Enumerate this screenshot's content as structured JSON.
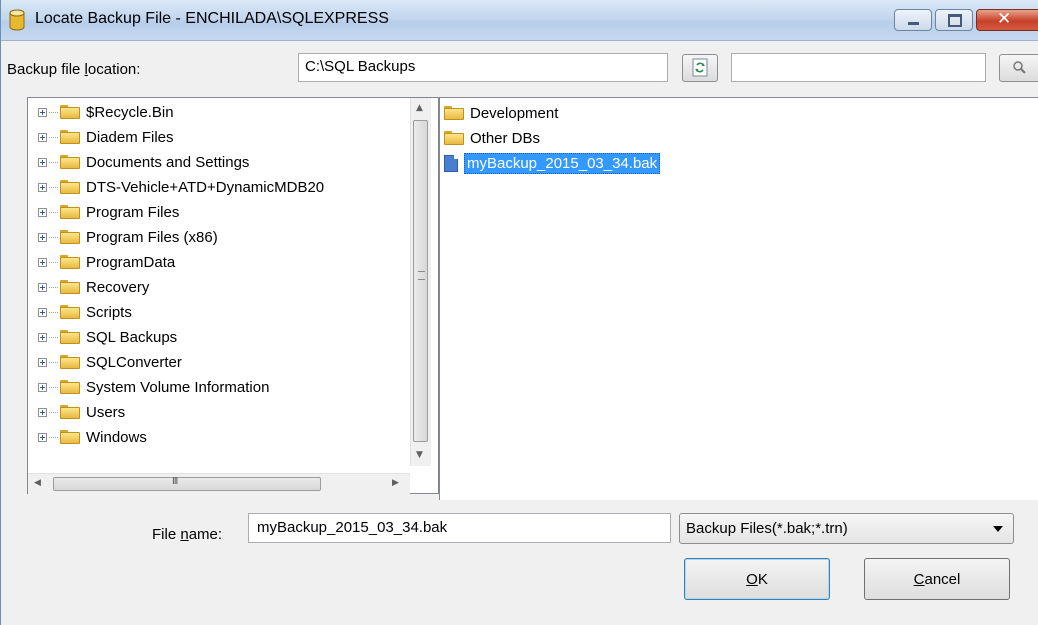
{
  "window": {
    "title": "Locate Backup File - ENCHILADA\\SQLEXPRESS"
  },
  "location": {
    "label_pre": "Backup file ",
    "label_accel": "l",
    "label_post": "ocation:",
    "path": "C:\\SQL Backups",
    "search_value": ""
  },
  "tree": {
    "items": [
      {
        "label": "$Recycle.Bin"
      },
      {
        "label": "Diadem Files"
      },
      {
        "label": "Documents and Settings"
      },
      {
        "label": "DTS-Vehicle+ATD+DynamicMDB20"
      },
      {
        "label": "Program Files"
      },
      {
        "label": "Program Files (x86)"
      },
      {
        "label": "ProgramData"
      },
      {
        "label": "Recovery"
      },
      {
        "label": "Scripts"
      },
      {
        "label": "SQL Backups"
      },
      {
        "label": "SQLConverter"
      },
      {
        "label": "System Volume Information"
      },
      {
        "label": "Users"
      },
      {
        "label": "Windows"
      }
    ],
    "hscroll_grip": "III"
  },
  "files": {
    "items": [
      {
        "label": "Development",
        "type": "folder"
      },
      {
        "label": "Other DBs",
        "type": "folder"
      },
      {
        "label": "myBackup_2015_03_34.bak",
        "type": "file",
        "selected": true
      }
    ]
  },
  "footer": {
    "filename_label_pre": "File ",
    "filename_label_accel": "n",
    "filename_label_post": "ame:",
    "filename_value": "myBackup_2015_03_34.bak",
    "filter_value": "Backup Files(*.bak;*.trn)",
    "ok_accel": "O",
    "ok_rest": "K",
    "cancel_accel": "C",
    "cancel_rest": "ancel"
  },
  "colors": {
    "selection": "#3399ff",
    "folder": "#e9b941",
    "titlebar": "#c3d7ef",
    "close_button": "#c7412a"
  },
  "icons": [
    "database-icon",
    "minimize-icon",
    "maximize-icon",
    "close-icon",
    "refresh-icon",
    "search-icon",
    "folder-icon",
    "expand-icon",
    "file-icon",
    "dropdown-arrow-icon"
  ]
}
